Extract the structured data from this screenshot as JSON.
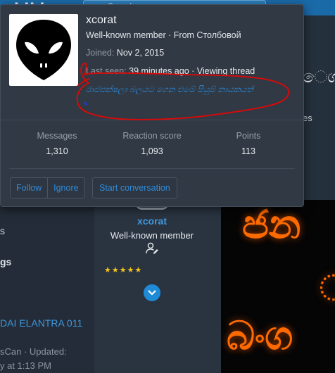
{
  "header": {
    "logo_fragment": "ʌkiki",
    "search_placeholder": "Search"
  },
  "background": {
    "sinhala_fragment": "ෙග",
    "es_fragment": "es",
    "left_s": "s",
    "left_gs": "gs",
    "thread_title": "DAI ELANTRA 011",
    "thread_meta_1": "sCan · Updated:",
    "thread_meta_2": "y at 1:13 PM"
  },
  "post": {
    "username": "xcorat",
    "user_title": "Well-known member",
    "stars": "★★★★★"
  },
  "card": {
    "username": "xcorat",
    "user_title": "Well-known member · From Столбовой",
    "joined_label": "Joined:",
    "joined_value": "Nov 2, 2015",
    "lastseen_label": "Last seen:",
    "lastseen_value": "39 minutes ago · Viewing thread",
    "signature": "රාජපක්ෂලා බලයට ගෙන එමේ සියුම් නායකයත්",
    "stats": {
      "messages_label": "Messages",
      "messages_value": "1,310",
      "reaction_label": "Reaction score",
      "reaction_value": "1,093",
      "points_label": "Points",
      "points_value": "113"
    },
    "buttons": {
      "follow": "Follow",
      "ignore": "Ignore",
      "start_conversation": "Start conversation"
    }
  },
  "post_image": {
    "glyph1": "ජන",
    "glyph2": "්",
    "glyph3": "බංග"
  },
  "colors": {
    "link": "#2f8bdc",
    "annotation": "#d40b0b",
    "card_bg": "#303944",
    "header_blue": "#1a6aa8"
  },
  "icons": {
    "avatar": "alien-head-icon",
    "user_badge": "user-edit-icon",
    "expand": "chevron-down-icon"
  }
}
